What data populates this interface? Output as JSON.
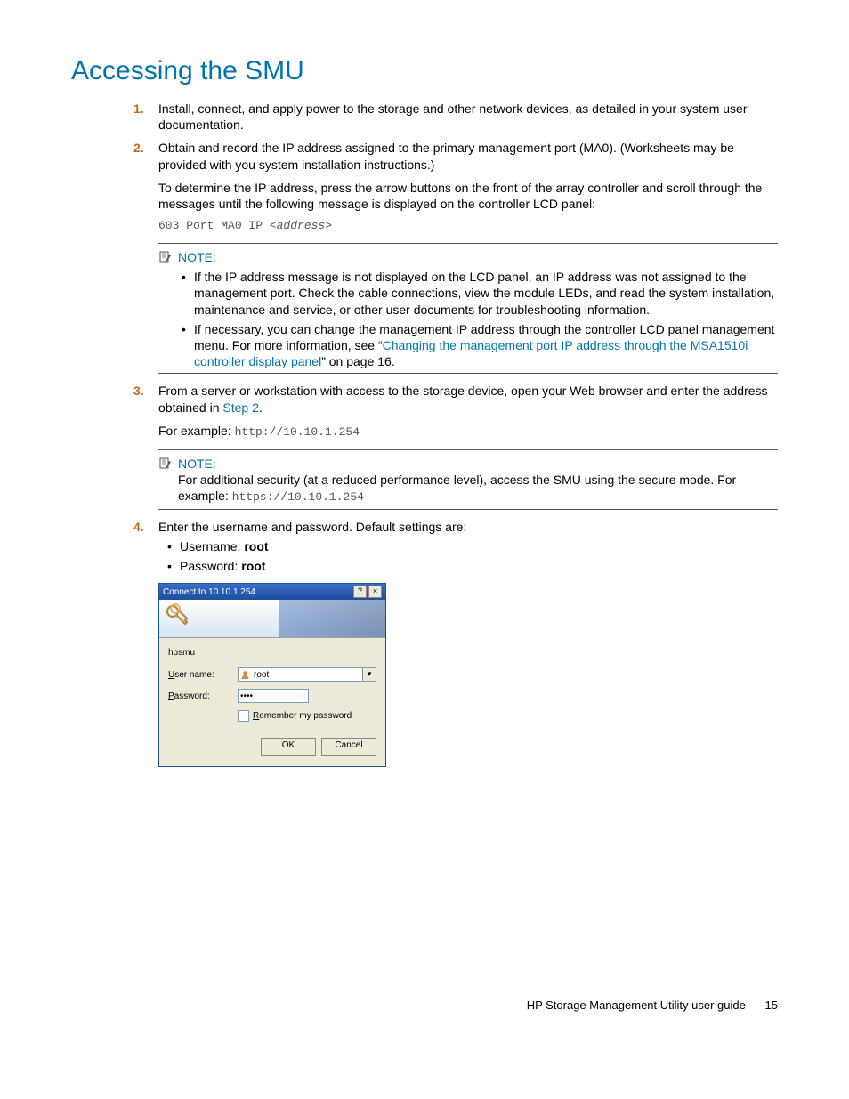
{
  "heading": "Accessing the SMU",
  "steps": {
    "s1": {
      "num": "1.",
      "text": "Install, connect, and apply power to the storage and other network devices, as detailed in your system user documentation."
    },
    "s2": {
      "num": "2.",
      "text": "Obtain and record the IP address assigned to the primary management port (MA0). (Worksheets may be provided with you system installation instructions.)",
      "para2": "To determine the IP address, press the arrow buttons on the front of the array controller and scroll through the messages until the following message is displayed on the controller LCD panel:",
      "code_prefix": "603 Port MA0 IP <",
      "code_italic": "address",
      "code_suffix": ">"
    },
    "s3": {
      "num": "3.",
      "text_a": "From a server or workstation with access to the storage device, open your Web browser and enter the address obtained in ",
      "link": "Step 2",
      "text_b": ".",
      "example_label": "For example: ",
      "example_code": "http://10.10.1.254"
    },
    "s4": {
      "num": "4.",
      "text": "Enter the username and password. Default settings are:",
      "bullets": {
        "b1_label": "Username: ",
        "b1_val": "root",
        "b2_label": "Password: ",
        "b2_val": "root"
      }
    }
  },
  "note1": {
    "label": "NOTE:",
    "b1": "If the IP address message is not displayed on the LCD panel, an IP address was not assigned to the management port. Check the cable connections, view the module LEDs, and read the system installation, maintenance and service, or other user documents for troubleshooting information.",
    "b2_a": "If necessary, you can change the management IP address through the controller LCD panel management menu. For more information, see “",
    "b2_link": "Changing the management port IP address through the MSA1510i controller display panel",
    "b2_b": "” on page 16."
  },
  "note2": {
    "label": "NOTE:",
    "body_a": "For additional security (at a reduced performance level), access the SMU using the secure mode. For example: ",
    "body_code": "https://10.10.1.254"
  },
  "dialog": {
    "title": "Connect to 10.10.1.254",
    "help_btn": "?",
    "close_btn": "×",
    "realm": "hpsmu",
    "username_label": "User name:",
    "username_value": "root",
    "password_label": "Password:",
    "password_value": "••••",
    "remember_label": "Remember my password",
    "ok": "OK",
    "cancel": "Cancel"
  },
  "footer": {
    "text": "HP Storage Management Utility user guide",
    "page": "15"
  }
}
